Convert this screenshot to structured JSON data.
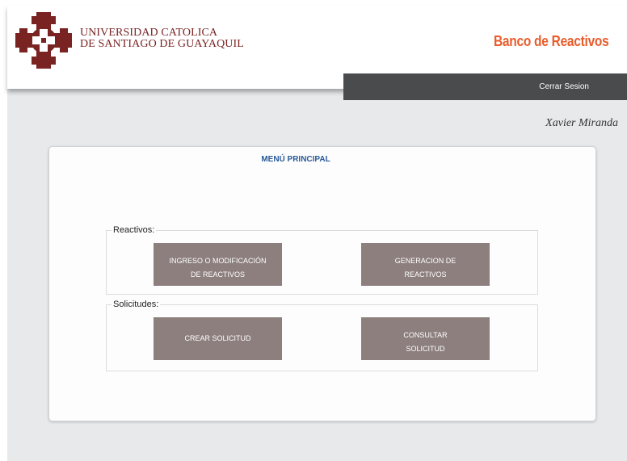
{
  "header": {
    "university_line1": "UNIVERSIDAD CATOLICA",
    "university_line2": "DE SANTIAGO DE GUAYAQUIL",
    "app_title": "Banco de Reactivos",
    "logo_icon": "university-cross-emblem-icon",
    "brand_color": "#7a2323"
  },
  "nav": {
    "logout_label": "Cerrar Sesion"
  },
  "user": {
    "name": "Xavier Miranda"
  },
  "menu": {
    "title": "MENÚ PRINCIPAL",
    "groups": [
      {
        "legend": "Reactivos:",
        "buttons": [
          {
            "line1": "INGRESO O MODIFICACIÓN",
            "line2": "DE REACTIVOS"
          },
          {
            "line1": "GENERACION DE",
            "line2": "REACTIVOS"
          }
        ]
      },
      {
        "legend": "Solicitudes:",
        "buttons": [
          {
            "line1": "CREAR SOLICITUD",
            "line2": ""
          },
          {
            "line1": "CONSULTAR",
            "line2": "SOLICITUD"
          }
        ]
      }
    ]
  },
  "colors": {
    "accent_orange": "#e85c2b",
    "title_blue": "#2a5a98",
    "button_bg": "#8c7f7e",
    "nav_bar": "#4a4b4d"
  }
}
